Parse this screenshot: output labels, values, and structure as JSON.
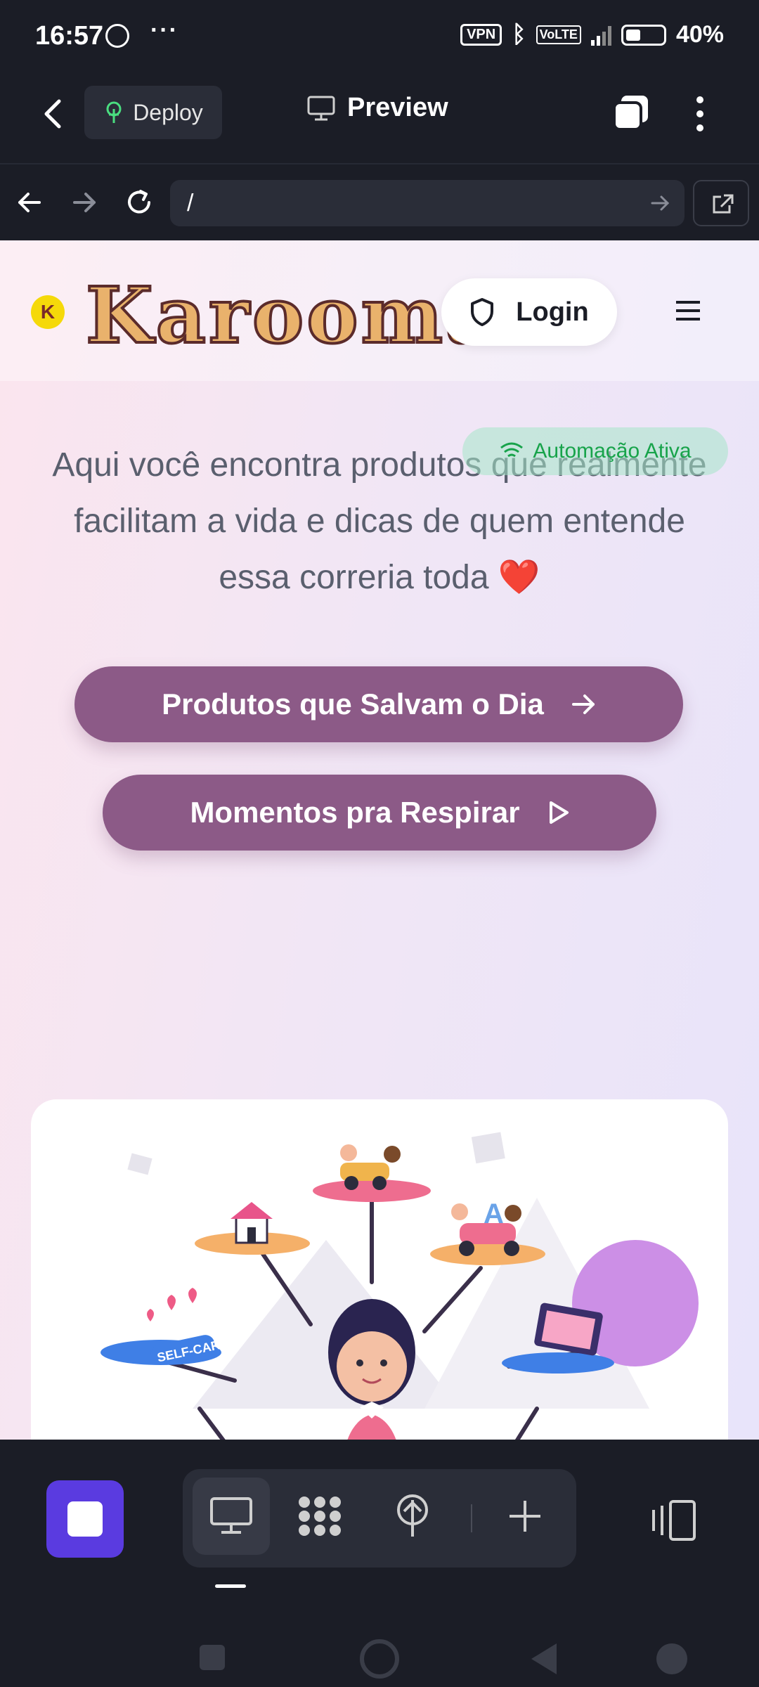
{
  "status_bar": {
    "time": "16:57",
    "vpn": "VPN",
    "battery": "40%"
  },
  "top_bar": {
    "deploy_label": "Deploy",
    "preview_label": "Preview"
  },
  "url_bar": {
    "url": "/"
  },
  "site": {
    "logo_text": "Karooma",
    "login_label": "Login",
    "automation_badge": "Automação Ativa",
    "hero_text": "Aqui você encontra produtos que realmente facilitam a vida e dicas de quem entende essa correria toda ❤️",
    "primary_cta": "Produtos que Salvam o Dia",
    "secondary_cta": "Momentos pra Respirar",
    "illustration_label": "SELF-CARE"
  },
  "colors": {
    "accent": "#8c5a87",
    "tool_accent": "#5a3be0",
    "badge_text": "#17a34a"
  }
}
